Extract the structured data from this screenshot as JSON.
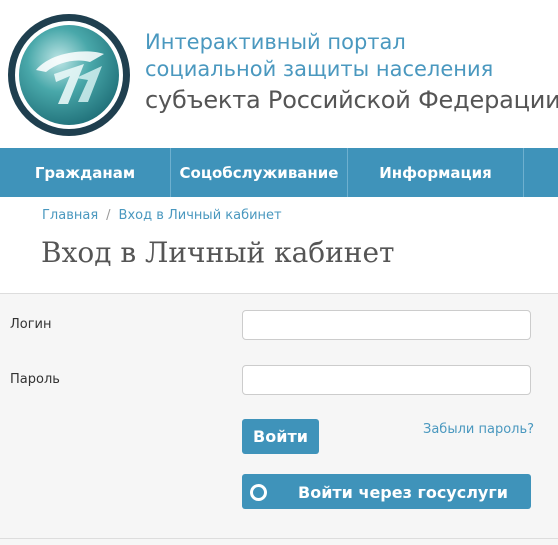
{
  "header": {
    "title_line1": "Интерактивный портал",
    "title_line2": "социальной защиты населения",
    "title_line3": "субъекта Российской Федерации",
    "logo_icon": "portal-logo-icon"
  },
  "nav": {
    "items": [
      {
        "label": "Гражданам"
      },
      {
        "label": "Соцобслуживание"
      },
      {
        "label": "Информация"
      },
      {
        "label": ""
      }
    ]
  },
  "breadcrumb": {
    "home": "Главная",
    "separator": "/",
    "current": "Вход в Личный кабинет"
  },
  "page": {
    "title": "Вход в Личный кабинет"
  },
  "form": {
    "login_label": "Логин",
    "login_value": "",
    "password_label": "Пароль",
    "password_value": "",
    "submit_label": "Войти",
    "forgot_label": "Забыли пароль?",
    "gosuslugi_label": "Войти через госуслуги"
  },
  "colors": {
    "accent": "#3f93ba",
    "link": "#4a98bf",
    "title_text": "#555555",
    "form_bg": "#f6f6f6"
  }
}
